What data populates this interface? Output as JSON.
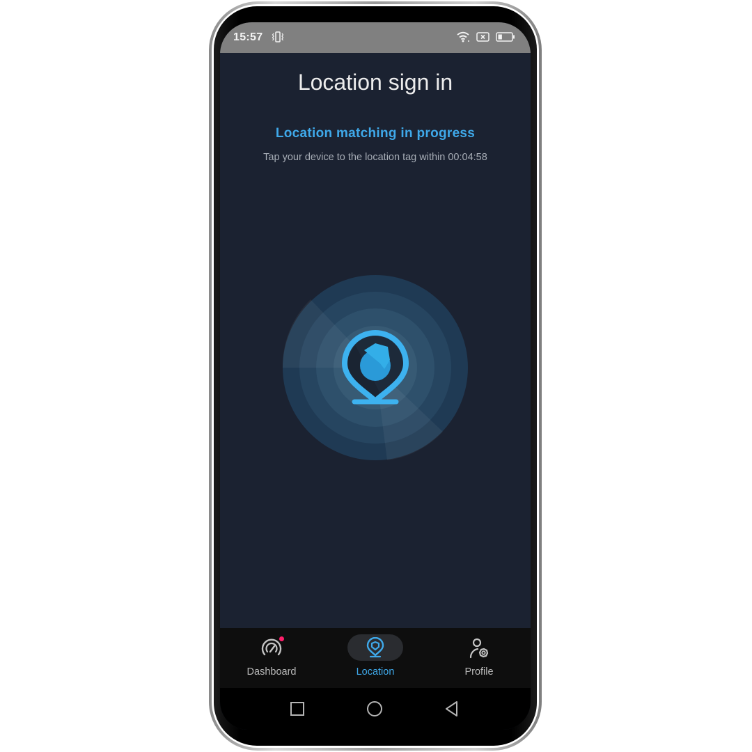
{
  "status_bar": {
    "time": "15:57",
    "icons": [
      "vibrate-icon",
      "wifi-icon",
      "no-sim-icon",
      "battery-icon"
    ],
    "battery_level": 0.3
  },
  "page": {
    "title": "Location sign in",
    "status": "Location matching in progress",
    "hint": "Tap your device to the location tag within 00:04:58",
    "countdown": "00:04:58",
    "scan_icon": "location-tag-icon",
    "colors": {
      "accent": "#3fa9ea",
      "background": "#1b2231",
      "radar_outer": "#1e3a54"
    }
  },
  "bottom_nav": {
    "items": [
      {
        "label": "Dashboard",
        "icon": "speedometer-icon",
        "active": false,
        "has_badge": true
      },
      {
        "label": "Location",
        "icon": "location-tag-icon",
        "active": true,
        "has_badge": false
      },
      {
        "label": "Profile",
        "icon": "user-settings-icon",
        "active": false,
        "has_badge": false
      }
    ],
    "badge_color": "#ff1f6b"
  },
  "system_nav": {
    "buttons": [
      "recent-apps",
      "home",
      "back"
    ]
  }
}
